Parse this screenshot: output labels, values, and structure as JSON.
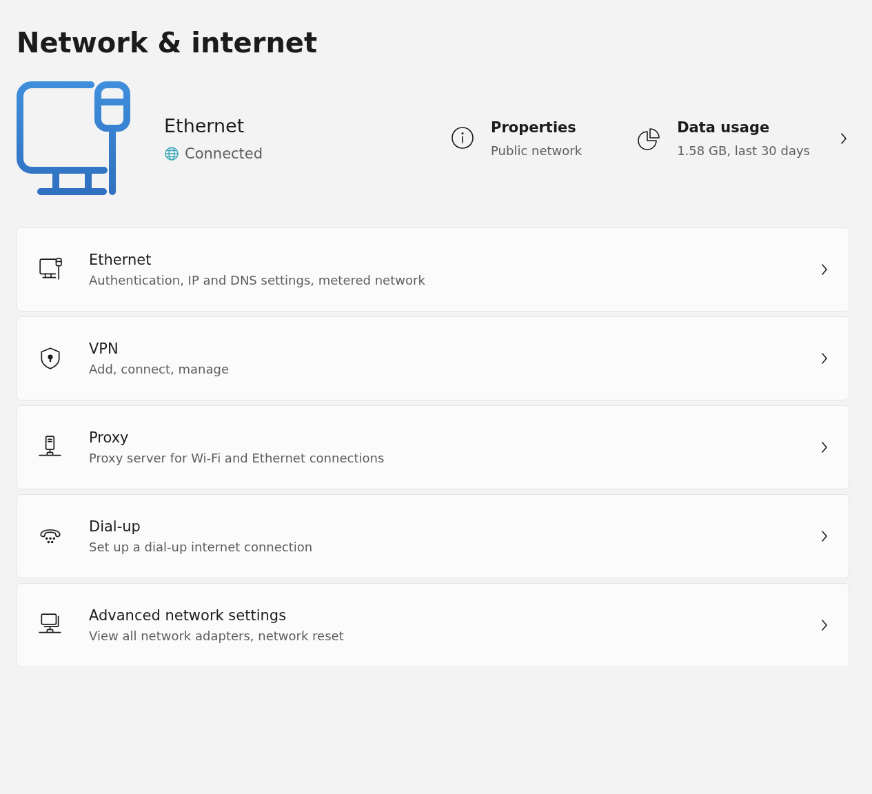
{
  "page_title": "Network & internet",
  "connection": {
    "name": "Ethernet",
    "status": "Connected",
    "connected": true
  },
  "quick_links": [
    {
      "kind": "info",
      "title": "Properties",
      "subtitle": "Public network",
      "chevron": false
    },
    {
      "kind": "pie",
      "title": "Data usage",
      "subtitle": "1.58 GB, last 30 days",
      "chevron": true
    }
  ],
  "settings": [
    {
      "kind": "ethernet",
      "title": "Ethernet",
      "subtitle": "Authentication, IP and DNS settings, metered network"
    },
    {
      "kind": "vpn",
      "title": "VPN",
      "subtitle": "Add, connect, manage"
    },
    {
      "kind": "proxy",
      "title": "Proxy",
      "subtitle": "Proxy server for Wi-Fi and Ethernet connections"
    },
    {
      "kind": "dialup",
      "title": "Dial-up",
      "subtitle": "Set up a dial-up internet connection"
    },
    {
      "kind": "advanced",
      "title": "Advanced network settings",
      "subtitle": "View all network adapters, network reset"
    }
  ]
}
